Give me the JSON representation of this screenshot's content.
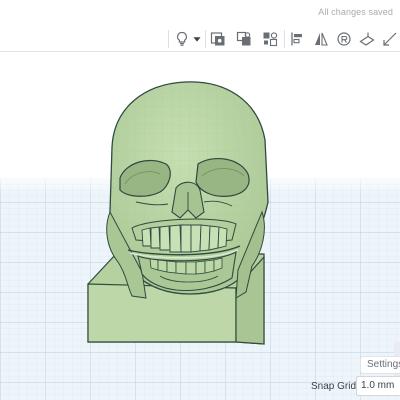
{
  "header": {
    "save_status": "All changes saved"
  },
  "toolbar": {
    "tools": [
      {
        "name": "note-tool",
        "icon": "lightbulb-icon"
      },
      {
        "name": "note-dropdown",
        "icon": "caret-down-icon"
      },
      {
        "name": "show-all-tool",
        "icon": "eye-box-icon"
      },
      {
        "name": "toggle-visibility-tool",
        "icon": "shape-stack-icon"
      },
      {
        "name": "group-tool",
        "icon": "group-shapes-icon"
      },
      {
        "name": "align-tool",
        "icon": "align-icon"
      },
      {
        "name": "mirror-tool",
        "icon": "mirror-icon"
      },
      {
        "name": "cruise-tool",
        "icon": "cruise-icon"
      },
      {
        "name": "workplane-tool",
        "icon": "workplane-icon"
      },
      {
        "name": "ruler-tool",
        "icon": "ruler-icon"
      }
    ]
  },
  "viewport": {
    "object_name": "skull-model",
    "object_color": "#b9d4a4",
    "grid_color": "#c7dbea",
    "background_color": "#eef5fa"
  },
  "footer": {
    "settings_label": "Settings",
    "snap_grid_label": "Snap Grid",
    "snap_grid_value": "1.0 mm"
  }
}
